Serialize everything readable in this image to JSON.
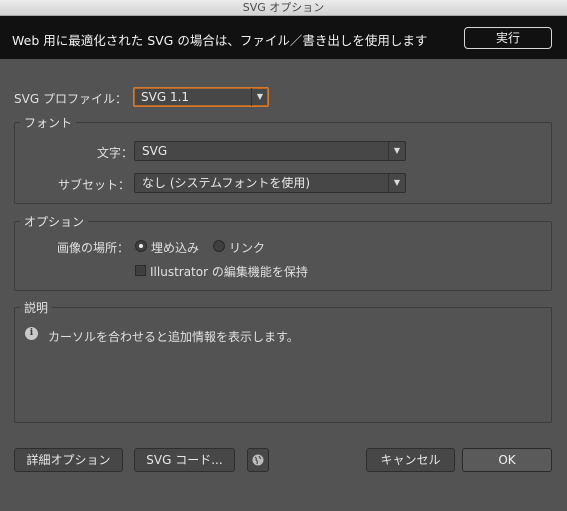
{
  "window": {
    "title": "SVG オプション"
  },
  "banner": {
    "text": "Web 用に最適化された SVG の場合は、ファイル／書き出しを使用します",
    "run_label": "実行"
  },
  "profile": {
    "label": "SVG プロファイル：",
    "value": "SVG 1.1"
  },
  "font_group": {
    "title": "フォント",
    "type_label": "文字：",
    "type_value": "SVG",
    "subset_label": "サブセット：",
    "subset_value": "なし (システムフォントを使用)"
  },
  "options_group": {
    "title": "オプション",
    "image_location_label": "画像の場所：",
    "embed_label": "埋め込み",
    "link_label": "リンク",
    "embed_selected": true,
    "preserve_label": "Illustrator の編集機能を保持",
    "preserve_checked": false
  },
  "description_group": {
    "title": "説明",
    "text": "カーソルを合わせると追加情報を表示します。"
  },
  "footer": {
    "advanced_label": "詳細オプション",
    "svg_code_label": "SVG コード...",
    "cancel_label": "キャンセル",
    "ok_label": "OK"
  },
  "colors": {
    "background": "#535353",
    "banner": "#111111",
    "focus_accent": "#d57b2f"
  },
  "icons": {
    "dropdown": "chevron-down-icon",
    "info": "info-icon",
    "globe": "globe-icon"
  }
}
